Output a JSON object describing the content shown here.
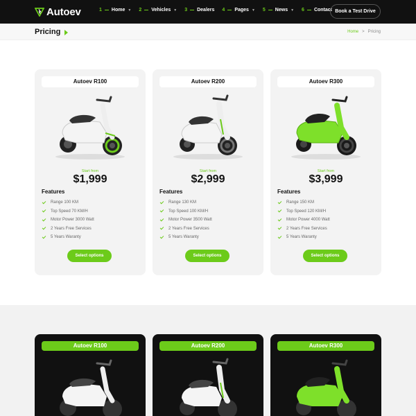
{
  "header": {
    "logo_text": "Autoev",
    "nav": [
      {
        "num": "1",
        "label": "Home",
        "dropdown": true
      },
      {
        "num": "2",
        "label": "Vehicles",
        "dropdown": true
      },
      {
        "num": "3",
        "label": "Dealers",
        "dropdown": false
      },
      {
        "num": "4",
        "label": "Pages",
        "dropdown": true
      },
      {
        "num": "5",
        "label": "News",
        "dropdown": true
      },
      {
        "num": "6",
        "label": "Contact",
        "dropdown": false
      }
    ],
    "cta_label": "Book a Test Drive"
  },
  "pagebar": {
    "title": "Pricing",
    "breadcrumb": {
      "home": "Home",
      "separator": ">",
      "current": "Pricing"
    }
  },
  "pricing_cards": [
    {
      "title": "Autoev R100",
      "start_label": "Start from",
      "price": "$1,999",
      "features_title": "Features",
      "features": [
        "Range 100 KM",
        "Top Speed 70 KM/H",
        "Motor Power 3000 Watt",
        "2 Years Free Services",
        "5 Years Waranty"
      ],
      "button": "Select options",
      "scooter_color": "white-green-accent"
    },
    {
      "title": "Autoev R200",
      "start_label": "Start from",
      "price": "$2,999",
      "features_title": "Features",
      "features": [
        "Range 130 KM",
        "Top Speed 100 KM/H",
        "Motor Power 3500 Watt",
        "2 Years Free Services",
        "5 Years Waranty"
      ],
      "button": "Select options",
      "scooter_color": "white-green-accent"
    },
    {
      "title": "Autoev R300",
      "start_label": "Start from",
      "price": "$3,999",
      "features_title": "Features",
      "features": [
        "Range 150 KM",
        "Top Speed 120 KM/H",
        "Motor Power 4000 Watt",
        "2 Years Free Services",
        "5 Years Waranty"
      ],
      "button": "Select options",
      "scooter_color": "green"
    }
  ],
  "dark_cards": [
    {
      "title": "Autoev R100"
    },
    {
      "title": "Autoev R200"
    },
    {
      "title": "Autoev R300"
    }
  ],
  "colors": {
    "accent": "#6ccb1a",
    "header_bg": "#111111",
    "card_bg": "#f3f3f3"
  }
}
